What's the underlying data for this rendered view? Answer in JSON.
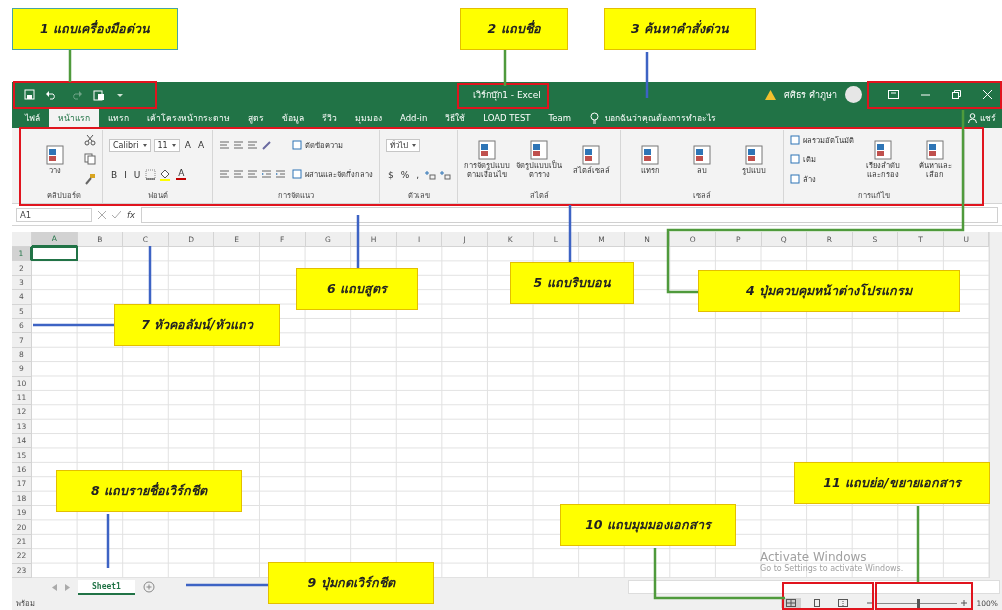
{
  "callouts": [
    {
      "text": "1 แถบเครื่องมือด่วน"
    },
    {
      "text": "2 แถบชื่อ"
    },
    {
      "text": "3 ค้นหาคำสั่งด่วน"
    },
    {
      "text": "4 ปุ่มควบคุมหน้าต่างโปรแกรม"
    },
    {
      "text": "5 แถบริบบอน"
    },
    {
      "text": "6 แถบสูตร"
    },
    {
      "text": "7 หัวคอลัมน์/หัวแถว"
    },
    {
      "text": "8 แถบรายชื่อเวิร์กชีต"
    },
    {
      "text": "9 ปุ่มกดเวิร์กชีต"
    },
    {
      "text": "10 แถบมุมมองเอกสาร"
    },
    {
      "text": "11 แถบย่อ/ขยายเอกสาร"
    }
  ],
  "title_bar": {
    "title": "เวิร์กบุ๊ก1 - Excel",
    "user": "ศศิธร คำภูษา"
  },
  "tabs": [
    {
      "label": "ไฟล์",
      "selected": false
    },
    {
      "label": "หน้าแรก",
      "selected": true
    },
    {
      "label": "แทรก",
      "selected": false
    },
    {
      "label": "เค้าโครงหน้ากระดาษ",
      "selected": false
    },
    {
      "label": "สูตร",
      "selected": false
    },
    {
      "label": "ข้อมูล",
      "selected": false
    },
    {
      "label": "รีวิว",
      "selected": false
    },
    {
      "label": "มุมมอง",
      "selected": false
    },
    {
      "label": "Add-in",
      "selected": false
    },
    {
      "label": "วิธีใช้",
      "selected": false
    },
    {
      "label": "LOAD TEST",
      "selected": false
    },
    {
      "label": "Team",
      "selected": false
    }
  ],
  "tell_me": {
    "placeholder": "บอกฉันว่าคุณต้องการทำอะไร"
  },
  "share": "แชร์",
  "ribbon": {
    "groups": [
      {
        "label": "คลิปบอร์ด",
        "columns": [
          [
            [
              {
                "kind": "big",
                "label": "วาง"
              }
            ]
          ],
          [
            [
              {
                "kind": "scissors"
              }
            ],
            [
              {
                "kind": "copy"
              }
            ],
            [
              {
                "kind": "brush"
              }
            ]
          ]
        ]
      },
      {
        "label": "ฟอนต์",
        "columns": [
          [
            [
              {
                "kind": "field",
                "value": "Calibri"
              },
              {
                "kind": "field",
                "value": "11"
              },
              {
                "kind": "glyph",
                "label": "A"
              },
              {
                "kind": "glyph",
                "label": "A"
              }
            ],
            [
              {
                "kind": "glyph",
                "label": "B"
              },
              {
                "kind": "glyph",
                "label": "I"
              },
              {
                "kind": "glyph",
                "label": "U"
              },
              {
                "kind": "border"
              },
              {
                "kind": "bucket"
              },
              {
                "kind": "fontcolor",
                "label": "A"
              }
            ]
          ]
        ]
      },
      {
        "label": "การจัดแนว",
        "columns": [
          [
            [
              {
                "kind": "lines"
              },
              {
                "kind": "lines"
              },
              {
                "kind": "lines"
              },
              {
                "kind": "orient"
              }
            ],
            [
              {
                "kind": "lines"
              },
              {
                "kind": "lines"
              },
              {
                "kind": "lines"
              },
              {
                "kind": "indent"
              },
              {
                "kind": "indent"
              }
            ]
          ],
          [
            [
              {
                "kind": "small",
                "label": "ตัดข้อความ"
              }
            ],
            [
              {
                "kind": "small",
                "label": "ผสานและจัดกึ่งกลาง"
              }
            ]
          ]
        ]
      },
      {
        "label": "ตัวเลข",
        "columns": [
          [
            [
              {
                "kind": "field",
                "value": "ทั่วไป"
              }
            ],
            [
              {
                "kind": "glyph",
                "label": "$"
              },
              {
                "kind": "glyph",
                "label": "%"
              },
              {
                "kind": "glyph",
                "label": ","
              },
              {
                "kind": "decimal"
              },
              {
                "kind": "decimal"
              }
            ]
          ]
        ]
      },
      {
        "label": "สไตล์",
        "columns": [
          [
            [
              {
                "kind": "big",
                "label": "การจัดรูปแบบตามเงื่อนไข"
              }
            ]
          ],
          [
            [
              {
                "kind": "big",
                "label": "จัดรูปแบบเป็นตาราง"
              }
            ]
          ],
          [
            [
              {
                "kind": "big",
                "label": "สไตล์เซลล์"
              }
            ]
          ]
        ]
      },
      {
        "label": "เซลล์",
        "columns": [
          [
            [
              {
                "kind": "big",
                "label": "แทรก"
              }
            ]
          ],
          [
            [
              {
                "kind": "big",
                "label": "ลบ"
              }
            ]
          ],
          [
            [
              {
                "kind": "big",
                "label": "รูปแบบ"
              }
            ]
          ]
        ]
      },
      {
        "label": "การแก้ไข",
        "columns": [
          [
            [
              {
                "kind": "small",
                "label": "ผลรวมอัตโนมัติ"
              }
            ],
            [
              {
                "kind": "small",
                "label": "เติม"
              }
            ],
            [
              {
                "kind": "small",
                "label": "ล้าง"
              }
            ]
          ],
          [
            [
              {
                "kind": "big",
                "label": "เรียงลำดับและกรอง"
              }
            ]
          ],
          [
            [
              {
                "kind": "big",
                "label": "ค้นหาและเลือก"
              }
            ]
          ]
        ]
      }
    ]
  },
  "formula_bar": {
    "name_box": "A1",
    "function_label": "fx"
  },
  "sheet": {
    "columns": [
      {
        "label": "A",
        "selected": true
      },
      {
        "label": "B",
        "selected": false
      },
      {
        "label": "C",
        "selected": false
      },
      {
        "label": "D",
        "selected": false
      },
      {
        "label": "E",
        "selected": false
      },
      {
        "label": "F",
        "selected": false
      },
      {
        "label": "G",
        "selected": false
      },
      {
        "label": "H",
        "selected": false
      },
      {
        "label": "I",
        "selected": false
      },
      {
        "label": "J",
        "selected": false
      },
      {
        "label": "K",
        "selected": false
      },
      {
        "label": "L",
        "selected": false
      },
      {
        "label": "M",
        "selected": false
      },
      {
        "label": "N",
        "selected": false
      },
      {
        "label": "O",
        "selected": false
      },
      {
        "label": "P",
        "selected": false
      },
      {
        "label": "Q",
        "selected": false
      },
      {
        "label": "R",
        "selected": false
      },
      {
        "label": "S",
        "selected": false
      },
      {
        "label": "T",
        "selected": false
      },
      {
        "label": "U",
        "selected": false
      }
    ],
    "rows": [
      {
        "label": "1",
        "selected": true
      },
      {
        "label": "2",
        "selected": false
      },
      {
        "label": "3",
        "selected": false
      },
      {
        "label": "4",
        "selected": false
      },
      {
        "label": "5",
        "selected": false
      },
      {
        "label": "6",
        "selected": false
      },
      {
        "label": "7",
        "selected": false
      },
      {
        "label": "8",
        "selected": false
      },
      {
        "label": "9",
        "selected": false
      },
      {
        "label": "10",
        "selected": false
      },
      {
        "label": "11",
        "selected": false
      },
      {
        "label": "12",
        "selected": false
      },
      {
        "label": "13",
        "selected": false
      },
      {
        "label": "14",
        "selected": false
      },
      {
        "label": "15",
        "selected": false
      },
      {
        "label": "16",
        "selected": false
      },
      {
        "label": "17",
        "selected": false
      },
      {
        "label": "18",
        "selected": false
      },
      {
        "label": "19",
        "selected": false
      },
      {
        "label": "20",
        "selected": false
      },
      {
        "label": "21",
        "selected": false
      },
      {
        "label": "22",
        "selected": false
      },
      {
        "label": "23",
        "selected": false
      }
    ]
  },
  "sheet_tabs": [
    {
      "label": "Sheet1",
      "selected": true
    }
  ],
  "activation_notice": {
    "title": "Activate Windows",
    "text": "Go to Settings to activate Windows."
  },
  "status_bar": {
    "status": "พร้อม",
    "views": [
      {
        "kind": "normal",
        "selected": true
      },
      {
        "kind": "layout",
        "selected": false
      },
      {
        "kind": "pagebreak",
        "selected": false
      }
    ],
    "zoom": {
      "level": 0.52
    },
    "zoom_label": "100%"
  }
}
